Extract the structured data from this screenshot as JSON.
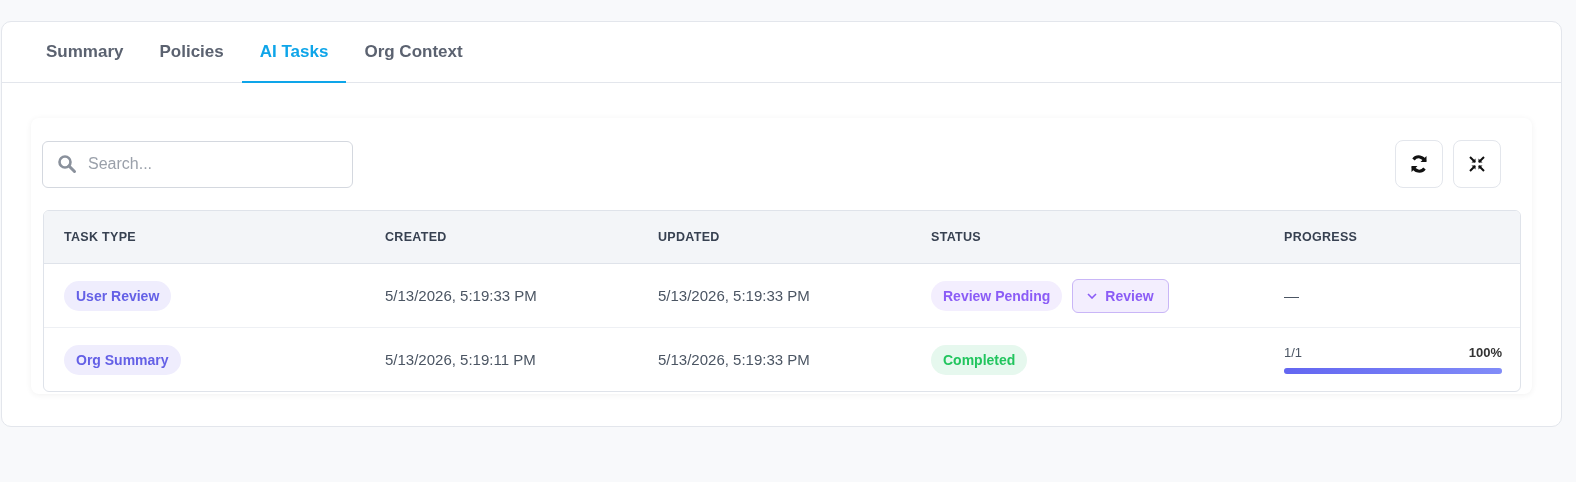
{
  "tabs": [
    {
      "label": "Summary",
      "selected": false
    },
    {
      "label": "Policies",
      "selected": false
    },
    {
      "label": "AI Tasks",
      "selected": true
    },
    {
      "label": "Org Context",
      "selected": false
    }
  ],
  "search": {
    "placeholder": "Search..."
  },
  "table": {
    "columns": [
      "TASK TYPE",
      "CREATED",
      "UPDATED",
      "STATUS",
      "PROGRESS"
    ],
    "rows": [
      {
        "task_type": "User Review",
        "created": "5/13/2026, 5:19:33 PM",
        "updated": "5/13/2026, 5:19:33 PM",
        "status": {
          "label": "Review Pending",
          "kind": "pending"
        },
        "action": {
          "label": "Review"
        },
        "progress": {
          "kind": "empty",
          "text": "—"
        }
      },
      {
        "task_type": "Org Summary",
        "created": "5/13/2026, 5:19:11 PM",
        "updated": "5/13/2026, 5:19:33 PM",
        "status": {
          "label": "Completed",
          "kind": "completed"
        },
        "progress": {
          "kind": "bar",
          "count": "1/1",
          "percent": "100%",
          "level": 1
        }
      }
    ]
  }
}
